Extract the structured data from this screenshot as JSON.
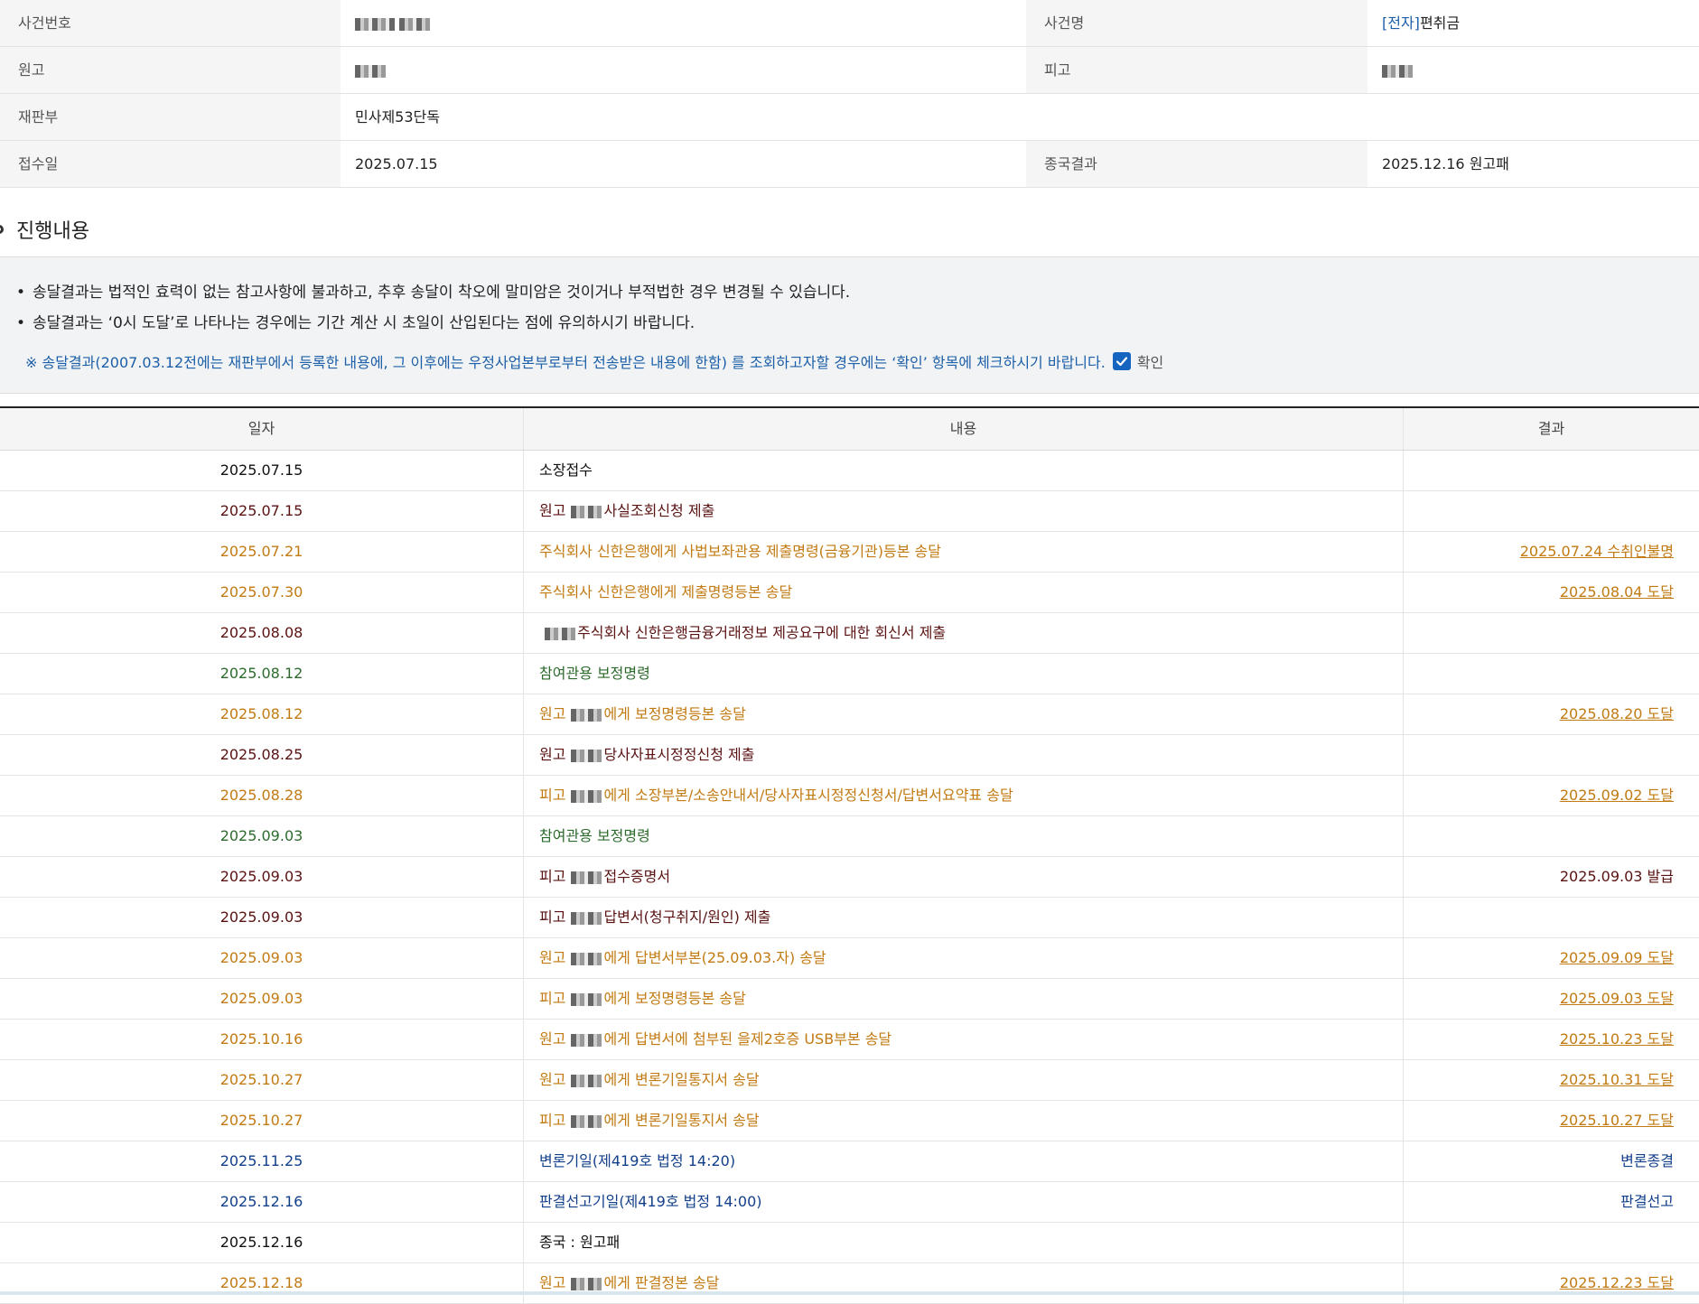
{
  "case_info": {
    "case_number_label": "사건번호",
    "case_name_label": "사건명",
    "case_name_prefix": "[전자]",
    "case_name_value": "편취금",
    "plaintiff_label": "원고",
    "defendant_label": "피고",
    "court_division_label": "재판부",
    "court_division_value": "민사제53단독",
    "filing_date_label": "접수일",
    "filing_date_value": "2025.07.15",
    "final_result_label": "종국결과",
    "final_result_value": "2025.12.16 원고패"
  },
  "section": {
    "title": "진행내용"
  },
  "notice": {
    "line1": "송달결과는 법적인 효력이 없는 참고사항에 불과하고, 추후 송달이 착오에 말미암은 것이거나 부적법한 경우 변경될 수 있습니다.",
    "line2": "송달결과는 ‘0시 도달’로 나타나는 경우에는 기간 계산 시 초일이 산입된다는 점에 유의하시기 바랍니다.",
    "note": "※ 송달결과(2007.03.12전에는 재판부에서 등록한 내용에, 그 이후에는 우정사업본부로부터 전송받은 내용에 한함) 를 조회하고자할 경우에는 ‘확인’ 항목에 체크하시기 바랍니다.",
    "confirm_label": "확인",
    "confirm_checked": true
  },
  "table": {
    "headers": {
      "date": "일자",
      "content": "내용",
      "result": "결과"
    },
    "rows": [
      {
        "date": "2025.07.15",
        "pre": "소장접수",
        "post": "",
        "result": "",
        "color": "black"
      },
      {
        "date": "2025.07.15",
        "pre": "원고",
        "post": "사실조회신청 제출",
        "result": "",
        "color": "maroon"
      },
      {
        "date": "2025.07.21",
        "pre": "주식회사 신한은행에게 사법보좌관용 제출명령(금융기관)등본 송달",
        "post": "",
        "result": "2025.07.24 수취인불명",
        "color": "orange",
        "link": true
      },
      {
        "date": "2025.07.30",
        "pre": "주식회사 신한은행에게 제출명령등본 송달",
        "post": "",
        "result": "2025.08.04 도달",
        "color": "orange",
        "link": true
      },
      {
        "date": "2025.08.08",
        "pre": "",
        "post": "주식회사 신한은행금융거래정보 제공요구에 대한 회신서 제출",
        "result": "",
        "color": "maroon"
      },
      {
        "date": "2025.08.12",
        "pre": "참여관용 보정명령",
        "post": "",
        "result": "",
        "color": "green"
      },
      {
        "date": "2025.08.12",
        "pre": "원고",
        "post": "에게 보정명령등본 송달",
        "result": "2025.08.20 도달",
        "color": "orange",
        "link": true
      },
      {
        "date": "2025.08.25",
        "pre": "원고",
        "post": "당사자표시정정신청 제출",
        "result": "",
        "color": "maroon"
      },
      {
        "date": "2025.08.28",
        "pre": "피고",
        "post": "에게 소장부본/소송안내서/당사자표시정정신청서/답변서요약표 송달",
        "result": "2025.09.02 도달",
        "color": "orange",
        "link": true
      },
      {
        "date": "2025.09.03",
        "pre": "참여관용 보정명령",
        "post": "",
        "result": "",
        "color": "green"
      },
      {
        "date": "2025.09.03",
        "pre": "피고",
        "post": "접수증명서",
        "result": "2025.09.03 발급",
        "color": "maroon"
      },
      {
        "date": "2025.09.03",
        "pre": "피고",
        "post": "답변서(청구취지/원인) 제출",
        "result": "",
        "color": "maroon"
      },
      {
        "date": "2025.09.03",
        "pre": "원고",
        "post": "에게 답변서부본(25.09.03.자) 송달",
        "result": "2025.09.09 도달",
        "color": "orange",
        "link": true
      },
      {
        "date": "2025.09.03",
        "pre": "피고",
        "post": "에게 보정명령등본 송달",
        "result": "2025.09.03 도달",
        "color": "orange",
        "link": true
      },
      {
        "date": "2025.10.16",
        "pre": "원고",
        "post": "에게 답변서에 첨부된 을제2호증 USB부본 송달",
        "result": "2025.10.23 도달",
        "color": "orange",
        "link": true
      },
      {
        "date": "2025.10.27",
        "pre": "원고",
        "post": "에게 변론기일통지서 송달",
        "result": "2025.10.31 도달",
        "color": "orange",
        "link": true
      },
      {
        "date": "2025.10.27",
        "pre": "피고",
        "post": "에게 변론기일통지서 송달",
        "result": "2025.10.27 도달",
        "color": "orange",
        "link": true
      },
      {
        "date": "2025.11.25",
        "pre": "변론기일(제419호 법정 14:20)",
        "post": "",
        "result": "변론종결",
        "color": "navy"
      },
      {
        "date": "2025.12.16",
        "pre": "판결선고기일(제419호 법정 14:00)",
        "post": "",
        "result": "판결선고",
        "color": "navy"
      },
      {
        "date": "2025.12.16",
        "pre": "종국 : 원고패",
        "post": "",
        "result": "",
        "color": "black"
      },
      {
        "date": "2025.12.18",
        "pre": "원고",
        "post": "에게 판결정본 송달",
        "result": "2025.12.23 도달",
        "color": "orange",
        "link": true
      }
    ]
  }
}
